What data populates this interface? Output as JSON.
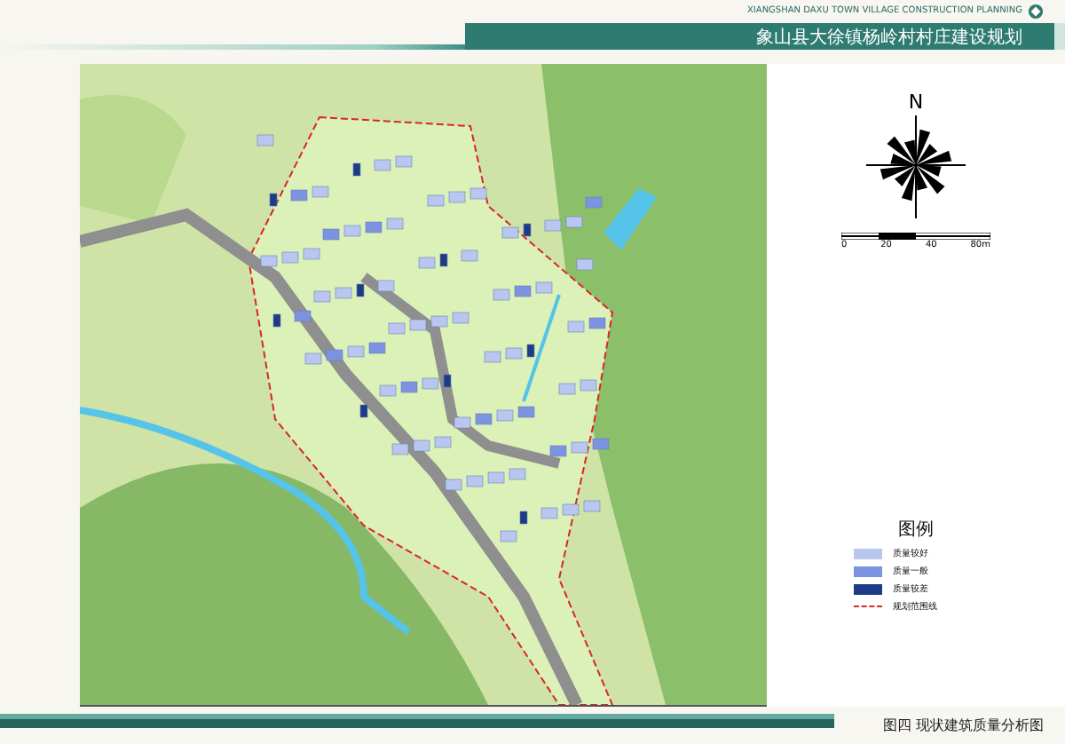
{
  "header": {
    "subtitle": "XIANGSHAN DAXU TOWN VILLAGE CONSTRUCTION PLANNING",
    "title": "象山县大徐镇杨岭村村庄建设规划"
  },
  "compass": {
    "label": "N"
  },
  "scale": {
    "labels": [
      "0",
      "20",
      "40",
      "80m"
    ]
  },
  "legend": {
    "title": "图例",
    "items": [
      {
        "kind": "swatch",
        "label": "质量较好",
        "color": "#b9c6ef"
      },
      {
        "kind": "swatch",
        "label": "质量一般",
        "color": "#7b93e0"
      },
      {
        "kind": "swatch",
        "label": "质量较差",
        "color": "#1d3b86"
      },
      {
        "kind": "line",
        "label": "规划范围线",
        "color": "#d8262a"
      }
    ]
  },
  "footer": {
    "caption": "图四  现状建筑质量分析图"
  }
}
